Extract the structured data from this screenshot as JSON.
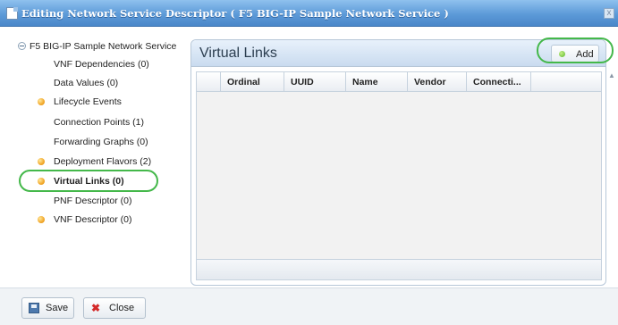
{
  "window": {
    "title": "Editing Network Service Descriptor ( F5 BIG-IP Sample Network Service )",
    "close_glyph": "x"
  },
  "tree": {
    "root_label": "F5 BIG-IP Sample Network Service",
    "items": [
      {
        "label": "VNF Dependencies (0)",
        "icon": null
      },
      {
        "label": "Data Values (0)",
        "icon": null
      },
      {
        "label": "Lifecycle Events",
        "icon": "orange-dot-icon"
      },
      {
        "label": "Connection Points (1)",
        "icon": null
      },
      {
        "label": "Forwarding Graphs (0)",
        "icon": null
      },
      {
        "label": "Deployment Flavors (2)",
        "icon": "orange-dot-icon"
      },
      {
        "label": "Virtual Links (0)",
        "icon": "orange-dot-icon",
        "selected": true
      },
      {
        "label": "PNF Descriptor (0)",
        "icon": null
      },
      {
        "label": "VNF Descriptor (0)",
        "icon": "orange-dot-icon"
      }
    ]
  },
  "panel": {
    "title": "Virtual Links",
    "add_label": "Add",
    "columns": [
      "",
      "Ordinal",
      "UUID",
      "Name",
      "Vendor",
      "Connecti..."
    ]
  },
  "footer": {
    "save_label": "Save",
    "close_label": "Close"
  },
  "colors": {
    "highlight": "#44b84a",
    "titlebar": "#5c9ad8",
    "status_dot": "#f2a72a"
  }
}
